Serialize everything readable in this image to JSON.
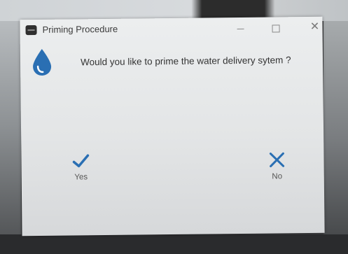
{
  "window": {
    "title": "Priming Procedure",
    "controls": {
      "minimize": "minimize-icon",
      "maximize": "maximize-icon",
      "close": "close-icon"
    }
  },
  "dialog": {
    "icon": "water-drop-icon",
    "message": "Would you like to prime the water delivery sytem ?",
    "accent_color": "#2a6fb3"
  },
  "actions": {
    "yes": {
      "label": "Yes",
      "icon": "checkmark-icon"
    },
    "no": {
      "label": "No",
      "icon": "x-mark-icon"
    }
  }
}
